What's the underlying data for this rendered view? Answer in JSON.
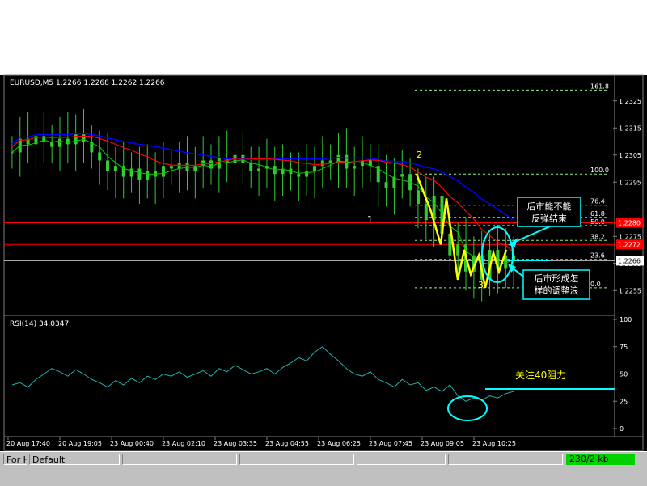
{
  "window": {
    "header": "EURUSD,M5  1.2266 1.2268 1.2262 1.2266"
  },
  "price_axis": {
    "ticks": [
      "1.2325",
      "1.2315",
      "1.2305",
      "1.2295",
      "1.2275",
      "1.2265",
      "1.2255"
    ],
    "red_labels": [
      "1.2280",
      "1.2272"
    ],
    "current": "1.2266"
  },
  "fib_levels": [
    {
      "label": "161.8",
      "price": 1.2329
    },
    {
      "label": "100.0",
      "price": 1.2298
    },
    {
      "label": "76.4",
      "price": 1.22865
    },
    {
      "label": "61.8",
      "price": 1.2282
    },
    {
      "label": "50.0",
      "price": 1.2279
    },
    {
      "label": "38.2",
      "price": 1.22735
    },
    {
      "label": "23.6",
      "price": 1.22665
    },
    {
      "label": "0.0",
      "price": 1.2256
    }
  ],
  "annotations": {
    "wave_1": "1",
    "wave_2": "2",
    "wave_3": "3",
    "callout_top": "后市能不能\n反弹结束",
    "callout_top_line1": "后市能不能",
    "callout_top_line2": "反弹结束",
    "callout_bottom_line1": "后市形成怎",
    "callout_bottom_line2": "样的调整浪",
    "rsi_note": "关注40阻力"
  },
  "rsi_panel": {
    "header": "RSI(14)  34.0347",
    "ticks": [
      "100",
      "75",
      "50",
      "25",
      "0"
    ]
  },
  "time_axis": {
    "labels": [
      "20 Aug 17:40",
      "20 Aug 19:05",
      "23 Aug 00:40",
      "23 Aug 02:10",
      "23 Aug 03:35",
      "23 Aug 04:55",
      "23 Aug 06:25",
      "23 Aug 07:45",
      "23 Aug 09:05",
      "23 Aug 10:25"
    ]
  },
  "status_bar": {
    "left": "For H",
    "profile": "Default",
    "traffic": "230/2 kb"
  },
  "colors": {
    "candles": "#32cd32",
    "ma_blue": "#0000ff",
    "ma_red": "#ff0000",
    "ma_green": "#00cc00",
    "fib": "#90ee90",
    "annotation_yellow": "#ffff00",
    "callout_cyan": "#00ffff",
    "rsi_line": "#20b2aa"
  },
  "chart_data": {
    "type": "line",
    "symbol": "EURUSD",
    "timeframe": "M5",
    "ohlc_last": {
      "open": 1.2266,
      "high": 1.2268,
      "low": 1.2262,
      "close": 1.2266
    },
    "price_range": [
      1.225,
      1.233
    ],
    "series": [
      {
        "name": "EURUSD,M5",
        "values": [
          1.2306,
          1.2311,
          1.2309,
          1.2312,
          1.231,
          1.2308,
          1.2311,
          1.2309,
          1.2313,
          1.231,
          1.2306,
          1.2303,
          1.2299,
          1.2301,
          1.2297,
          1.23,
          1.2296,
          1.2299,
          1.2297,
          1.2301,
          1.23,
          1.2302,
          1.2299,
          1.2301,
          1.2303,
          1.23,
          1.2304,
          1.2302,
          1.2305,
          1.2302,
          1.2299,
          1.23,
          1.2301,
          1.2298,
          1.23,
          1.2298,
          1.2297,
          1.2299,
          1.2301,
          1.2303,
          1.2302,
          1.2305,
          1.23,
          1.2301,
          1.2303,
          1.2301,
          1.2295,
          1.2293,
          1.2297,
          1.2298,
          1.2292,
          1.2287,
          1.2281,
          1.229,
          1.2276,
          1.2268,
          1.2272,
          1.2262,
          1.2268,
          1.2259,
          1.227,
          1.2263,
          1.2268,
          1.2266
        ]
      },
      {
        "name": "RSI(14)",
        "values": [
          40,
          42,
          38,
          45,
          50,
          55,
          52,
          48,
          54,
          50,
          45,
          42,
          38,
          44,
          40,
          46,
          42,
          48,
          45,
          50,
          48,
          52,
          47,
          50,
          53,
          48,
          55,
          52,
          58,
          54,
          50,
          52,
          55,
          50,
          56,
          60,
          65,
          62,
          70,
          75,
          68,
          62,
          55,
          50,
          48,
          52,
          45,
          42,
          38,
          45,
          40,
          42,
          35,
          38,
          34,
          40,
          30,
          25,
          28,
          26,
          30,
          28,
          32,
          34
        ]
      }
    ]
  }
}
